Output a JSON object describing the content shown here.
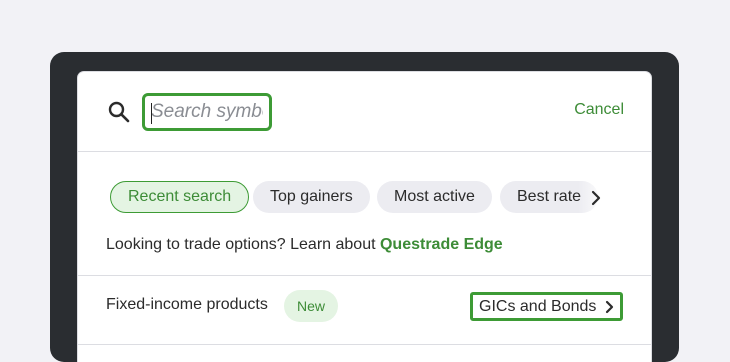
{
  "search": {
    "placeholder": "Search symbol",
    "cancel_label": "Cancel"
  },
  "chips": [
    {
      "label": "Recent search",
      "active": true
    },
    {
      "label": "Top gainers",
      "active": false
    },
    {
      "label": "Most active",
      "active": false
    },
    {
      "label": "Best rate",
      "active": false
    }
  ],
  "options_prompt": {
    "text": "Looking to trade options? Learn about ",
    "link": "Questrade Edge"
  },
  "fixed_income": {
    "label": "Fixed-income products",
    "badge": "New",
    "button_label": "GICs and Bonds"
  },
  "icons": {
    "search": "search-icon",
    "chips_next": "chevron-right-icon",
    "gics_chevron": "chevron-right-icon"
  },
  "colors": {
    "accent": "#3d9b35",
    "accent_text": "#3d8c37",
    "badge_bg": "#e4f4e3",
    "chip_bg": "#ececf1",
    "frame": "#2a2d31"
  }
}
